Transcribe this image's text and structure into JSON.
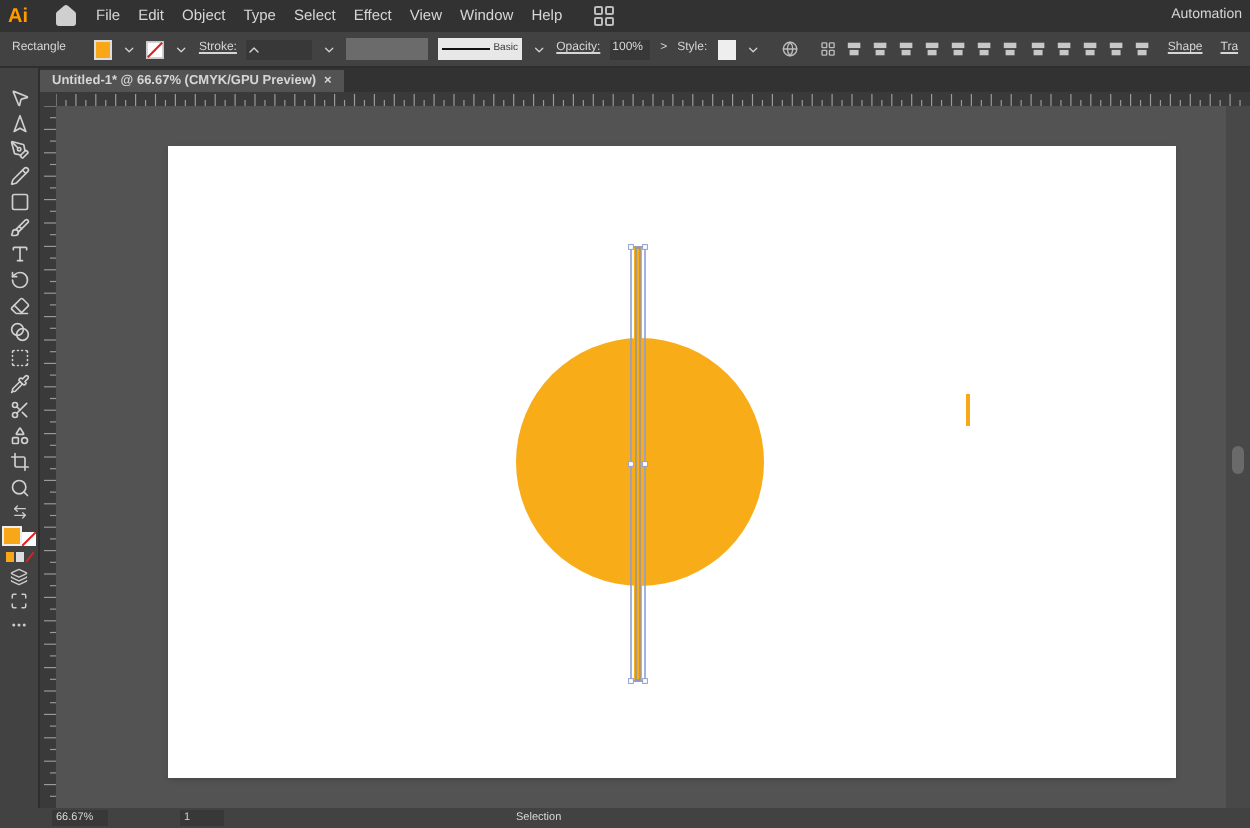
{
  "app": {
    "logo": "Ai",
    "menu": [
      "File",
      "Edit",
      "Object",
      "Type",
      "Select",
      "Effect",
      "View",
      "Window",
      "Help"
    ],
    "workspace": "Automation"
  },
  "control_bar": {
    "object_type": "Rectangle",
    "stroke_label": "Stroke:",
    "stroke_profile": "Basic",
    "opacity_label": "Opacity:",
    "opacity": "100%",
    "more": ">",
    "style_label": "Style:",
    "shape_link": "Shape",
    "transform_link": "Tra"
  },
  "document_tab": {
    "title": "Untitled-1* @ 66.67% (CMYK/GPU Preview)",
    "close": "×"
  },
  "status_bar": {
    "zoom": "66.67%",
    "artboard": "1",
    "tool": "Selection"
  }
}
